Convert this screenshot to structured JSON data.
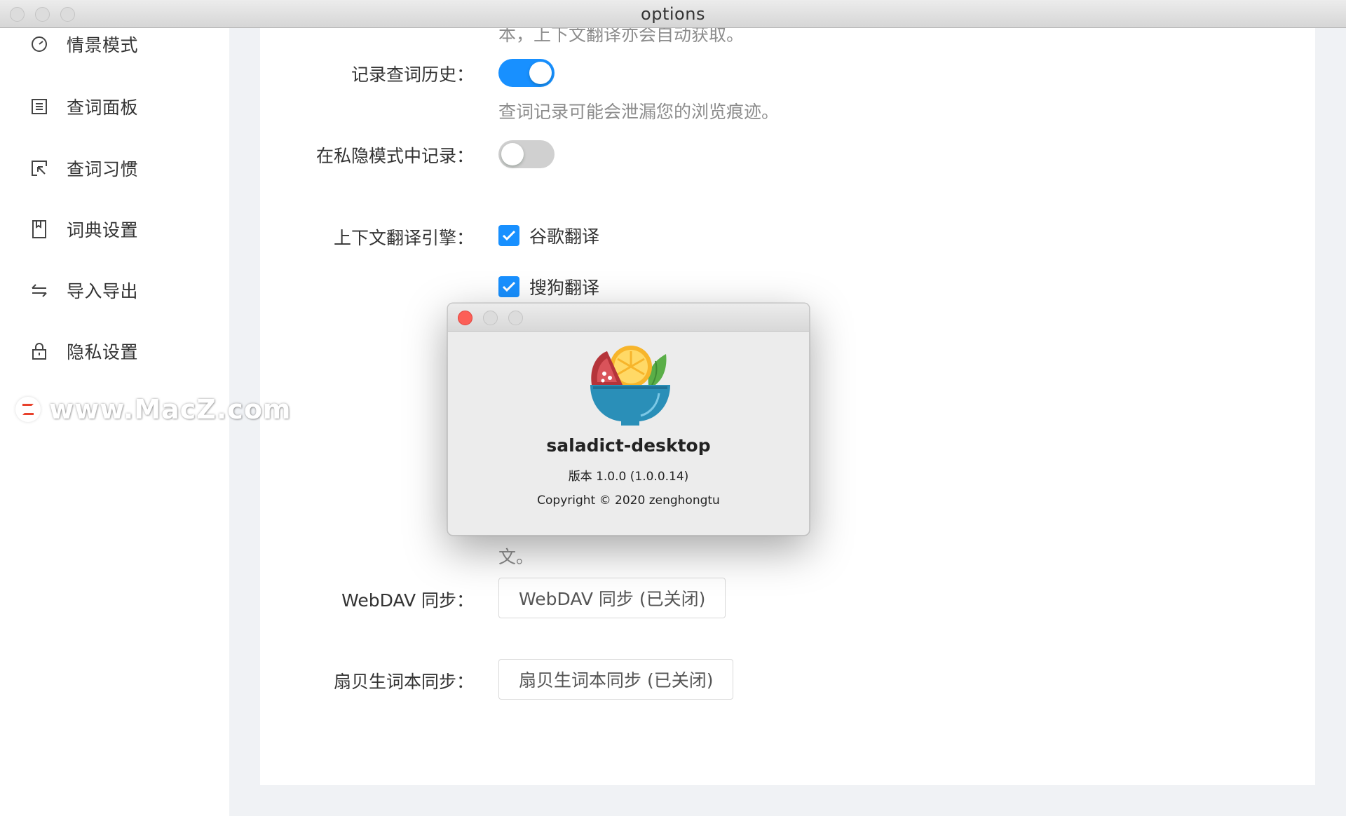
{
  "window": {
    "title": "options"
  },
  "sidebar": {
    "items": [
      {
        "label": "情景模式",
        "icon": "dashboard-icon"
      },
      {
        "label": "查词面板",
        "icon": "panel-icon"
      },
      {
        "label": "查词习惯",
        "icon": "select-icon"
      },
      {
        "label": "词典设置",
        "icon": "book-icon"
      },
      {
        "label": "导入导出",
        "icon": "swap-icon"
      },
      {
        "label": "隐私设置",
        "icon": "lock-icon"
      }
    ]
  },
  "watermark": {
    "text": "www.MacZ.com"
  },
  "settings": {
    "top_hint": "本，上下文翻译亦会自动获取。",
    "history": {
      "label": "记录查词历史：",
      "enabled": true,
      "hint": "查词记录可能会泄漏您的浏览痕迹。"
    },
    "incognito": {
      "label": "在私隐模式中记录：",
      "enabled": false
    },
    "context_engine": {
      "label": "上下文翻译引擎：",
      "options": [
        {
          "label": "谷歌翻译",
          "checked": true
        },
        {
          "label": "搜狗翻译",
          "checked": true
        }
      ]
    },
    "bottom_hint": "文。",
    "webdav": {
      "label": "WebDAV 同步：",
      "button": "WebDAV 同步 (已关闭)"
    },
    "shanbay": {
      "label": "扇贝生词本同步：",
      "button": "扇贝生词本同步 (已关闭)"
    }
  },
  "about_dialog": {
    "app_name": "saladict-desktop",
    "version": "版本 1.0.0 (1.0.0.14)",
    "copyright": "Copyright © 2020 zenghongtu"
  },
  "colors": {
    "accent": "#1890ff",
    "close": "#fc5f57"
  }
}
